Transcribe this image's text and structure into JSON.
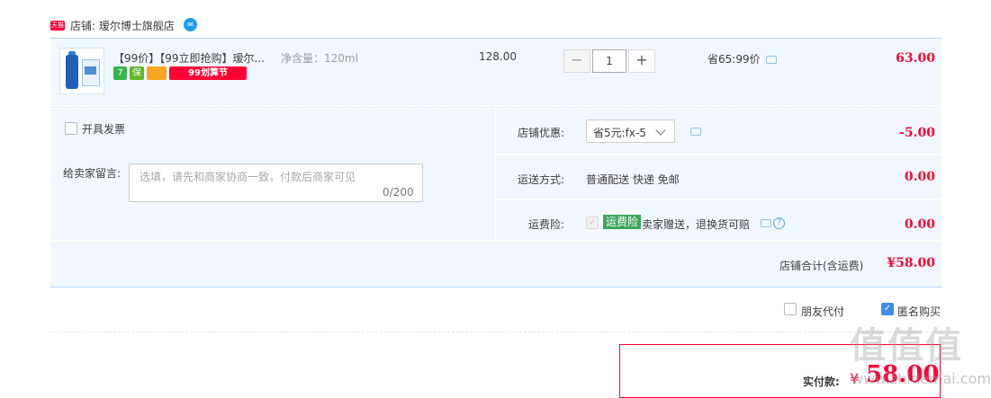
{
  "store": {
    "badge": "天猫",
    "label": "店铺: 瑷尔博士旗舰店",
    "wangwang_icon": "chat-bubble-icon"
  },
  "item": {
    "title": "【99价】【99立即抢购】瑷尔...",
    "spec": "净含量：120ml",
    "price": "128.00",
    "quantity": "1",
    "minus": "−",
    "plus": "+",
    "save_text": "省65:99价",
    "subtotal": "63.00",
    "tags": [
      "7",
      "保",
      "",
      "99划算节"
    ]
  },
  "invoice": {
    "label": "开具发票",
    "checked": false
  },
  "remark": {
    "label": "给卖家留言:",
    "placeholder": "选填，请先和商家协商一致，付款后商家可见",
    "count": "0/200"
  },
  "coupon": {
    "label": "店铺优惠:",
    "selected": "省5元:fx-5",
    "amount": "-5.00"
  },
  "shipping": {
    "label": "运送方式:",
    "value": "普通配送 快递 免邮",
    "amount": "0.00"
  },
  "insurance": {
    "label": "运费险:",
    "tag": "运费险",
    "text": "卖家赠送，退换货可赔",
    "help": "?",
    "amount": "0.00"
  },
  "total": {
    "label": "店铺合计(含运费)",
    "amount": "¥58.00"
  },
  "options": {
    "friend_pay": {
      "label": "朋友代付",
      "checked": false
    },
    "anonymous": {
      "label": "匿名购买",
      "checked": true
    }
  },
  "payment": {
    "label": "实付款:",
    "currency": "¥",
    "amount": "58.00"
  },
  "watermark": {
    "text": "值值值",
    "url": "www.zhidemai.com"
  },
  "colors": {
    "accent": "#ff0036",
    "panel": "#f2f7ff",
    "border": "#b2d1ff",
    "check": "#3d8eea"
  }
}
